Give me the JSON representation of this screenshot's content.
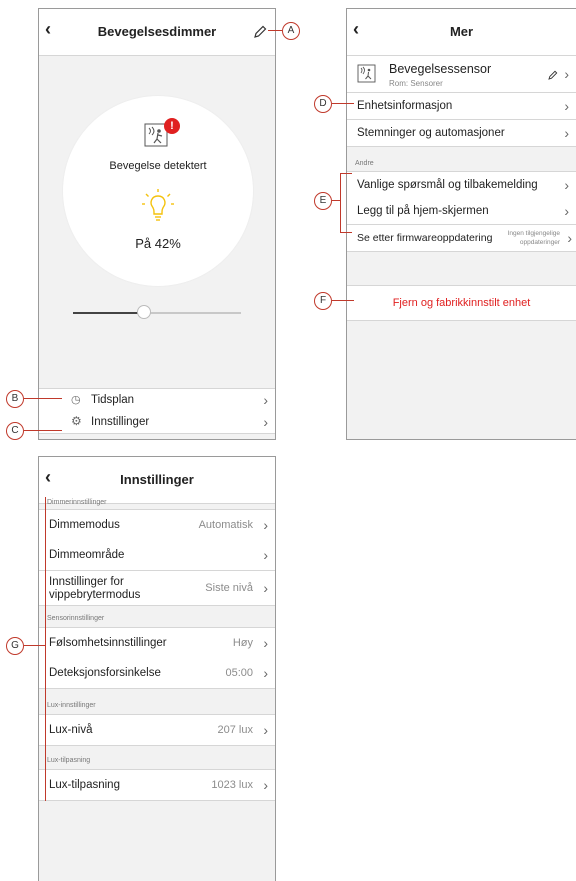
{
  "dimmer": {
    "title": "Bevegelsesdimmer",
    "motion_status": "Bevegelse detektert",
    "alert_badge": "!",
    "level_text": "På 42%",
    "slider_level": 0.42,
    "schedule_label": "Tidsplan",
    "settings_label": "Innstillinger"
  },
  "more": {
    "title": "Mer",
    "device_name": "Bevegelsessensor",
    "device_room": "Rom: Sensorer",
    "rows": [
      "Enhetsinformasjon",
      "Stemninger og automasjoner"
    ],
    "section_other": "Andre",
    "other_rows": [
      "Vanlige spørsmål og tilbakemelding",
      "Legg til på hjem-skjermen"
    ],
    "firmware_label": "Se etter firmwareoppdatering",
    "firmware_status_1": "Ingen tilgjengelige",
    "firmware_status_2": "oppdateringer",
    "remove_label": "Fjern og fabrikkinnstilt enhet"
  },
  "settings": {
    "title": "Innstillinger",
    "sec_dimmer": "Dimmerinnstillinger",
    "dimmemodus": "Dimmemodus",
    "dimmemodus_val": "Automatisk",
    "dimmeomrade": "Dimmeområde",
    "vippe_1": "Innstillinger for",
    "vippe_2": "vippebrytermodus",
    "vippe_val": "Siste nivå",
    "sec_sensor": "Sensorinnstillinger",
    "folsomhet": "Følsomhetsinnstillinger",
    "folsomhet_val": "Høy",
    "deteksjon": "Deteksjonsforsinkelse",
    "deteksjon_val": "05:00",
    "sec_lux": "Lux-innstillinger",
    "luxniva": "Lux-nivå",
    "luxniva_val": "207 lux",
    "sec_luxtilp": "Lux-tilpasning",
    "luxtilp": "Lux-tilpasning",
    "luxtilp_val": "1023 lux"
  },
  "callouts": [
    "A",
    "B",
    "C",
    "D",
    "E",
    "F",
    "G"
  ],
  "colors": {
    "accent_red": "#e02020",
    "bulb_yellow": "#f4c20d",
    "callout": "#c0392b"
  }
}
